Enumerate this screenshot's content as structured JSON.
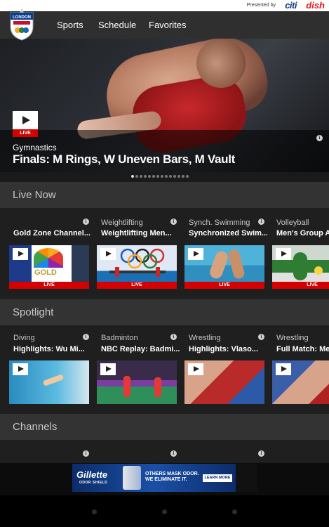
{
  "header": {
    "presented_by": "Presented by",
    "sponsor1": "citi",
    "sponsor2": "dish",
    "logo_text": "LONDON",
    "nav": [
      "Sports",
      "Schedule",
      "Favorites"
    ]
  },
  "hero": {
    "live_label": "LIVE",
    "sport": "Gymnastics",
    "title": "Finals: M Rings, W Uneven Bars, M Vault",
    "info": "i",
    "dot_count": 14,
    "active_dot": 0
  },
  "sections": {
    "live_now": {
      "title": "Live Now",
      "cards": [
        {
          "sport": "",
          "title": "Gold Zone Channel...",
          "live": "LIVE",
          "info": "i"
        },
        {
          "sport": "Weightlifting",
          "title": "Weightlifting Men...",
          "live": "LIVE",
          "info": "i"
        },
        {
          "sport": "Synch. Swimming",
          "title": "Synchronized Swim...",
          "live": "LIVE",
          "info": "i"
        },
        {
          "sport": "Volleyball",
          "title": "Men's Group A:",
          "live": "LIVE",
          "info": ""
        }
      ],
      "gold_label": "GOLD"
    },
    "spotlight": {
      "title": "Spotlight",
      "cards": [
        {
          "sport": "Diving",
          "title": "Highlights: Wu Mi...",
          "info": "i"
        },
        {
          "sport": "Badminton",
          "title": "NBC Replay: Badmi...",
          "info": "i"
        },
        {
          "sport": "Wrestling",
          "title": "Highlights: Vlaso...",
          "info": "i"
        },
        {
          "sport": "Wrestling",
          "title": "Full Match: Men",
          "info": ""
        }
      ]
    },
    "channels": {
      "title": "Channels",
      "info": [
        "i",
        "i",
        "i"
      ]
    }
  },
  "ad": {
    "brand": "Gillette",
    "sub": "ODOR SHIELD",
    "message_line1": "OTHERS MASK ODOR.",
    "message_line2": "WE ELIMINATE IT.",
    "cta": "LEARN MORE"
  },
  "colors": {
    "live_red": "#d60000",
    "section_header": "#333333",
    "nav_bg": "#2f2f2f"
  }
}
